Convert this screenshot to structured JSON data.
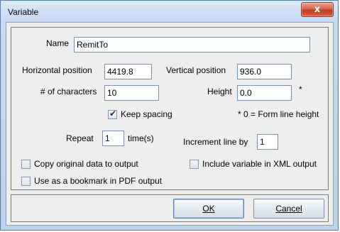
{
  "window": {
    "title": "Variable",
    "close_glyph": "x"
  },
  "form": {
    "name_label": "Name",
    "name_value": "RemitTo",
    "horizontal_label": "Horizontal position",
    "horizontal_value": "4419.8",
    "vertical_label": "Vertical position",
    "vertical_value": "936.0",
    "chars_label": "# of characters",
    "chars_value": "10",
    "height_label": "Height",
    "height_value": "0.0",
    "height_asterisk": "*",
    "keep_spacing_label": "Keep spacing",
    "keep_spacing_checked": true,
    "height_note": "* 0 = Form line height",
    "repeat_label": "Repeat",
    "repeat_value": "1",
    "repeat_unit": "time(s)",
    "increment_label": "Increment line by",
    "increment_value": "1",
    "copy_original_label": "Copy original data to output",
    "copy_original_checked": false,
    "include_xml_label": "Include variable in XML output",
    "include_xml_checked": false,
    "bookmark_label": "Use as a bookmark in PDF output",
    "bookmark_checked": false
  },
  "buttons": {
    "ok": "OK",
    "cancel": "Cancel"
  },
  "icons": {
    "close": "close-icon",
    "checkmark": "checkmark-icon"
  }
}
